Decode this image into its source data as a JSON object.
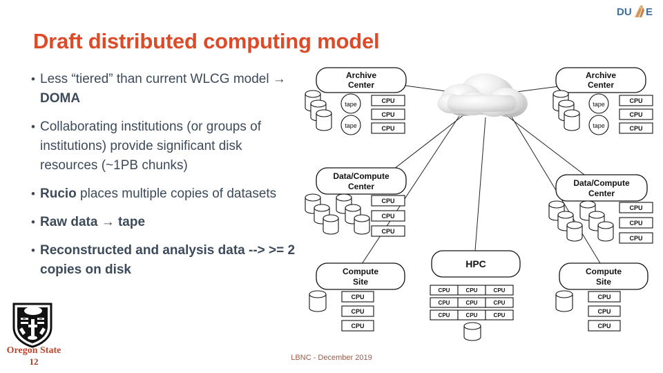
{
  "slide": {
    "title": "Draft distributed computing model",
    "page_number": "12",
    "footer": "LBNC - December 2019",
    "title_color": "#DC4A28",
    "body_color": "#3C4A5A"
  },
  "logos": {
    "dune": {
      "name": "DUNE",
      "part_a": "DU",
      "part_b": "E",
      "blue": "#3D6E9E",
      "tan": "#D99A5B"
    },
    "oregon_state": {
      "wordmark": "Oregon State",
      "color": "#C0452A"
    }
  },
  "bullets": [
    {
      "id": "b1",
      "bold": false,
      "html": "Less “tiered” than current WLCG model → <b>DOMA</b>",
      "text": "Less “tiered” than current WLCG model → DOMA"
    },
    {
      "id": "b2",
      "bold": false,
      "html": "Collaborating institutions (or groups of institutions) provide significant disk resources (~1PB chunks)",
      "text": "Collaborating institutions (or groups of institutions) provide significant disk resources (~1PB chunks)"
    },
    {
      "id": "b3",
      "bold": false,
      "html": "<b>Rucio</b> places multiple copies of datasets",
      "text": "Rucio places multiple copies of datasets"
    },
    {
      "id": "b4",
      "bold": true,
      "html": "Raw data → tape",
      "text": "Raw data → tape"
    },
    {
      "id": "b5",
      "bold": true,
      "html": "Reconstructed and analysis data --> >= 2 copies on disk",
      "text": "Reconstructed and analysis data --> >= 2 copies on disk"
    }
  ],
  "diagram": {
    "hub": {
      "label": "cloud",
      "type": "cloud"
    },
    "nodes": [
      {
        "id": "archive-left",
        "label": "Archive Center",
        "label_lines": [
          "Archive",
          "Center"
        ],
        "disks": 3,
        "tapes": 2,
        "cpus": 3,
        "cpu_layout": "column"
      },
      {
        "id": "archive-right",
        "label": "Archive Center",
        "label_lines": [
          "Archive",
          "Center"
        ],
        "disks": 3,
        "tapes": 2,
        "cpus": 3,
        "cpu_layout": "column"
      },
      {
        "id": "datacompute-left",
        "label": "Data/Compute Center",
        "label_lines": [
          "Data/Compute",
          "Center"
        ],
        "disks": 6,
        "tapes": 0,
        "cpus": 3,
        "cpu_layout": "column"
      },
      {
        "id": "datacompute-right",
        "label": "Data/Compute Center",
        "label_lines": [
          "Data/Compute",
          "Center"
        ],
        "disks": 6,
        "tapes": 0,
        "cpus": 3,
        "cpu_layout": "column"
      },
      {
        "id": "hpc",
        "label": "HPC",
        "label_lines": [
          "HPC"
        ],
        "disks": 1,
        "tapes": 0,
        "cpus": 9,
        "cpu_layout": "grid-3x3"
      },
      {
        "id": "compute-left",
        "label": "Compute Site",
        "label_lines": [
          "Compute",
          "Site"
        ],
        "disks": 1,
        "tapes": 0,
        "cpus": 3,
        "cpu_layout": "column"
      },
      {
        "id": "compute-right",
        "label": "Compute Site",
        "label_lines": [
          "Compute",
          "Site"
        ],
        "disks": 1,
        "tapes": 0,
        "cpus": 3,
        "cpu_layout": "column"
      }
    ],
    "cpu_label": "CPU",
    "tape_label": "tape"
  }
}
